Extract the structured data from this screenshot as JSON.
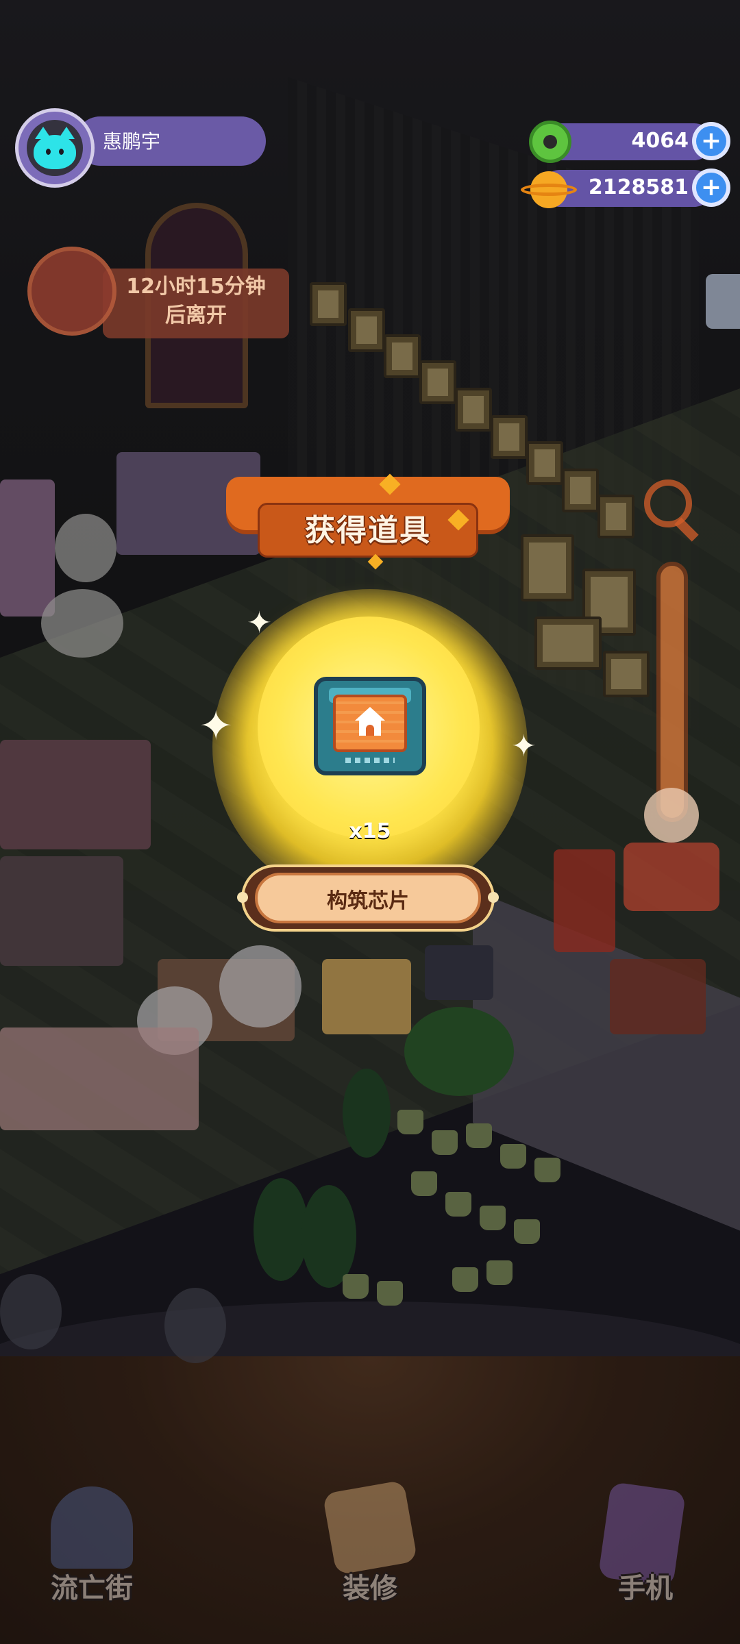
{
  "player": {
    "name": "惠鹏宇",
    "avatar_icon": "cat-avatar-icon"
  },
  "currencies": [
    {
      "name": "donut-coin",
      "icon": "donut-icon",
      "value": "4064"
    },
    {
      "name": "planet-coin",
      "icon": "planet-icon",
      "value": "2128581"
    }
  ],
  "timer": {
    "line1": "12小时15分钟",
    "line2": "后离开"
  },
  "reward": {
    "title": "获得道具",
    "item_icon": "build-chip-icon",
    "quantity": "x15",
    "item_name": "构筑芯片"
  },
  "bottom_nav": [
    {
      "label": "流亡街",
      "icon": "street-portal-icon"
    },
    {
      "label": "装修",
      "icon": "decorate-hammer-icon"
    },
    {
      "label": "手机",
      "icon": "phone-icon"
    }
  ],
  "colors": {
    "hud_bar": "#6454a6",
    "plus_button": "#3d8ff0",
    "ribbon": "#e06a1f",
    "glow": "#ffe34d",
    "name_pill": "#f6c99a"
  }
}
